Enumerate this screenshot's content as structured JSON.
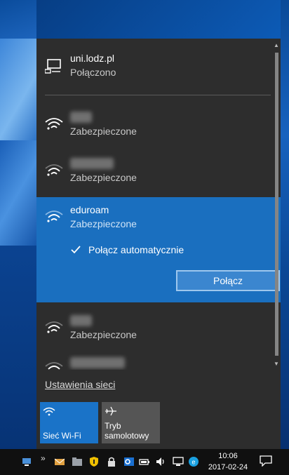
{
  "connected": {
    "name": "uni.lodz.pl",
    "status": "Połączono",
    "icon": "ethernet-icon"
  },
  "networks": [
    {
      "name": "",
      "status": "Zabezpieczone",
      "blurred": true
    },
    {
      "name": "",
      "status": "Zabezpieczone",
      "blurred": true
    },
    {
      "name": "eduroam",
      "status": "Zabezpieczone",
      "blurred": false
    },
    {
      "name": "",
      "status": "Zabezpieczone",
      "blurred": true
    },
    {
      "name": "",
      "status": "",
      "blurred": true
    }
  ],
  "selected": {
    "auto_connect_label": "Połącz automatycznie",
    "auto_connect_checked": true,
    "connect_button": "Połącz"
  },
  "settings_link": "Ustawienia sieci",
  "tiles": [
    {
      "label": "Sieć Wi-Fi",
      "icon": "wifi-icon",
      "active": true
    },
    {
      "label": "Tryb samolotowy",
      "icon": "airplane-icon",
      "active": false
    }
  ],
  "taskbar": {
    "time": "10:06",
    "date": "2017-02-24",
    "icons": [
      "network-icon",
      "chevron-icon",
      "mail-icon",
      "folder-icon",
      "shield-icon",
      "lock-icon",
      "app-icon",
      "outlook-icon",
      "battery-icon",
      "volume-icon",
      "monitor-icon",
      "skype-icon",
      "notification-icon"
    ]
  },
  "colors": {
    "flyout_bg": "#2d2d2d",
    "accent": "#1a6fbf",
    "tile_active": "#1a73c8",
    "tile_inactive": "#555555",
    "taskbar": "#101010"
  }
}
